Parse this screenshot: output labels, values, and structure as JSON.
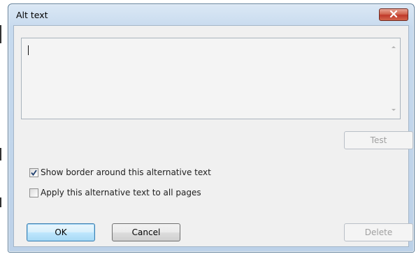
{
  "dialog": {
    "title": "Alt text",
    "close_icon": "close-x-icon",
    "close_color": "#c0392b"
  },
  "textarea": {
    "value": ""
  },
  "buttons": {
    "test_label": "Test",
    "ok_label": "OK",
    "cancel_label": "Cancel",
    "delete_label": "Delete"
  },
  "options": {
    "show_border_label": "Show border around this alternative text",
    "show_border_checked": true,
    "apply_all_label": "Apply this alternative text to all pages",
    "apply_all_checked": false
  },
  "accent": "#3c7fb1"
}
